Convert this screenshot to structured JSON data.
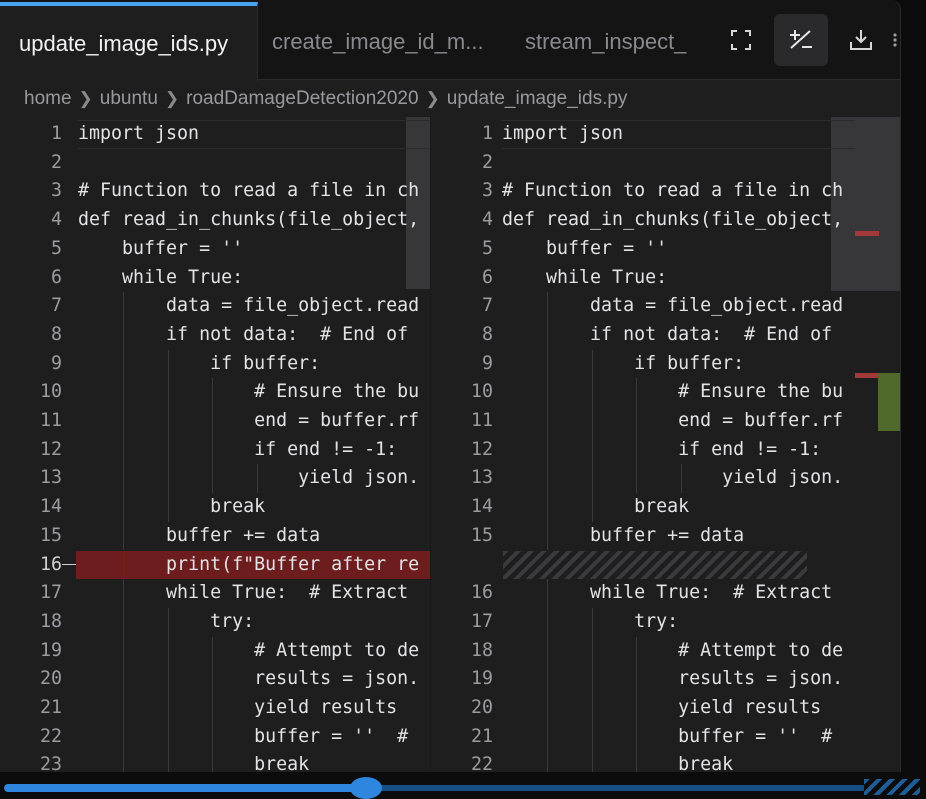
{
  "tabs": [
    {
      "label": "update_image_ids.py",
      "active": true
    },
    {
      "label": "create_image_id_m...",
      "active": false
    },
    {
      "label": "stream_inspect_",
      "active": false
    }
  ],
  "toolbar": {
    "fullscreen_icon": "expand-icon",
    "diff_icon": "plus-minus-icon",
    "download_icon": "download-icon",
    "more_icon": "more-icon"
  },
  "breadcrumb": [
    "home",
    "ubuntu",
    "roadDamageDetection2020",
    "update_image_ids.py"
  ],
  "colors": {
    "accent": "#4aa3f0",
    "deleted": "#6e1d1f",
    "added_marker": "#4f6a2a",
    "deleted_marker": "#a33a3a"
  },
  "left_pane": {
    "lines": [
      {
        "n": "1",
        "text": "import json"
      },
      {
        "n": "2",
        "text": ""
      },
      {
        "n": "3",
        "text": "# Function to read a file in ch"
      },
      {
        "n": "4",
        "text": "def read_in_chunks(file_object,"
      },
      {
        "n": "5",
        "text": "    buffer = ''"
      },
      {
        "n": "6",
        "text": "    while True:"
      },
      {
        "n": "7",
        "text": "        data = file_object.read"
      },
      {
        "n": "8",
        "text": "        if not data:  # End of"
      },
      {
        "n": "9",
        "text": "            if buffer:"
      },
      {
        "n": "10",
        "text": "                # Ensure the bu"
      },
      {
        "n": "11",
        "text": "                end = buffer.rf"
      },
      {
        "n": "12",
        "text": "                if end != -1:"
      },
      {
        "n": "13",
        "text": "                    yield json."
      },
      {
        "n": "14",
        "text": "            break"
      },
      {
        "n": "15",
        "text": "        buffer += data"
      },
      {
        "n": "16",
        "text": "        print(f\"Buffer after re",
        "deleted": true
      },
      {
        "n": "17",
        "text": "        while True:  # Extract"
      },
      {
        "n": "18",
        "text": "            try:"
      },
      {
        "n": "19",
        "text": "                # Attempt to de"
      },
      {
        "n": "20",
        "text": "                results = json."
      },
      {
        "n": "21",
        "text": "                yield results"
      },
      {
        "n": "22",
        "text": "                buffer = ''  #"
      },
      {
        "n": "23",
        "text": "                break"
      }
    ]
  },
  "right_pane": {
    "lines": [
      {
        "n": "1",
        "text": "import json"
      },
      {
        "n": "2",
        "text": ""
      },
      {
        "n": "3",
        "text": "# Function to read a file in ch"
      },
      {
        "n": "4",
        "text": "def read_in_chunks(file_object,"
      },
      {
        "n": "5",
        "text": "    buffer = ''"
      },
      {
        "n": "6",
        "text": "    while True:"
      },
      {
        "n": "7",
        "text": "        data = file_object.read"
      },
      {
        "n": "8",
        "text": "        if not data:  # End of"
      },
      {
        "n": "9",
        "text": "            if buffer:"
      },
      {
        "n": "10",
        "text": "                # Ensure the bu"
      },
      {
        "n": "11",
        "text": "                end = buffer.rf"
      },
      {
        "n": "12",
        "text": "                if end != -1:"
      },
      {
        "n": "13",
        "text": "                    yield json."
      },
      {
        "n": "14",
        "text": "            break"
      },
      {
        "n": "15",
        "text": "        buffer += data"
      },
      {
        "n": "",
        "text": "",
        "filler": true
      },
      {
        "n": "16",
        "text": "        while True:  # Extract"
      },
      {
        "n": "17",
        "text": "            try:"
      },
      {
        "n": "18",
        "text": "                # Attempt to de"
      },
      {
        "n": "19",
        "text": "                results = json."
      },
      {
        "n": "20",
        "text": "                yield results"
      },
      {
        "n": "21",
        "text": "                buffer = ''  #"
      },
      {
        "n": "22",
        "text": "                break"
      }
    ]
  },
  "horizontal_scroll": {
    "position": 0.42
  }
}
